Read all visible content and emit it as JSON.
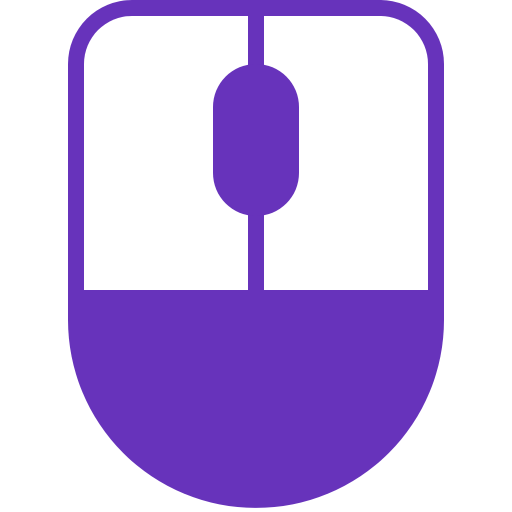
{
  "icon": {
    "name": "computer-mouse-icon",
    "color": "#6733BB",
    "background": "#FFFFFF"
  }
}
